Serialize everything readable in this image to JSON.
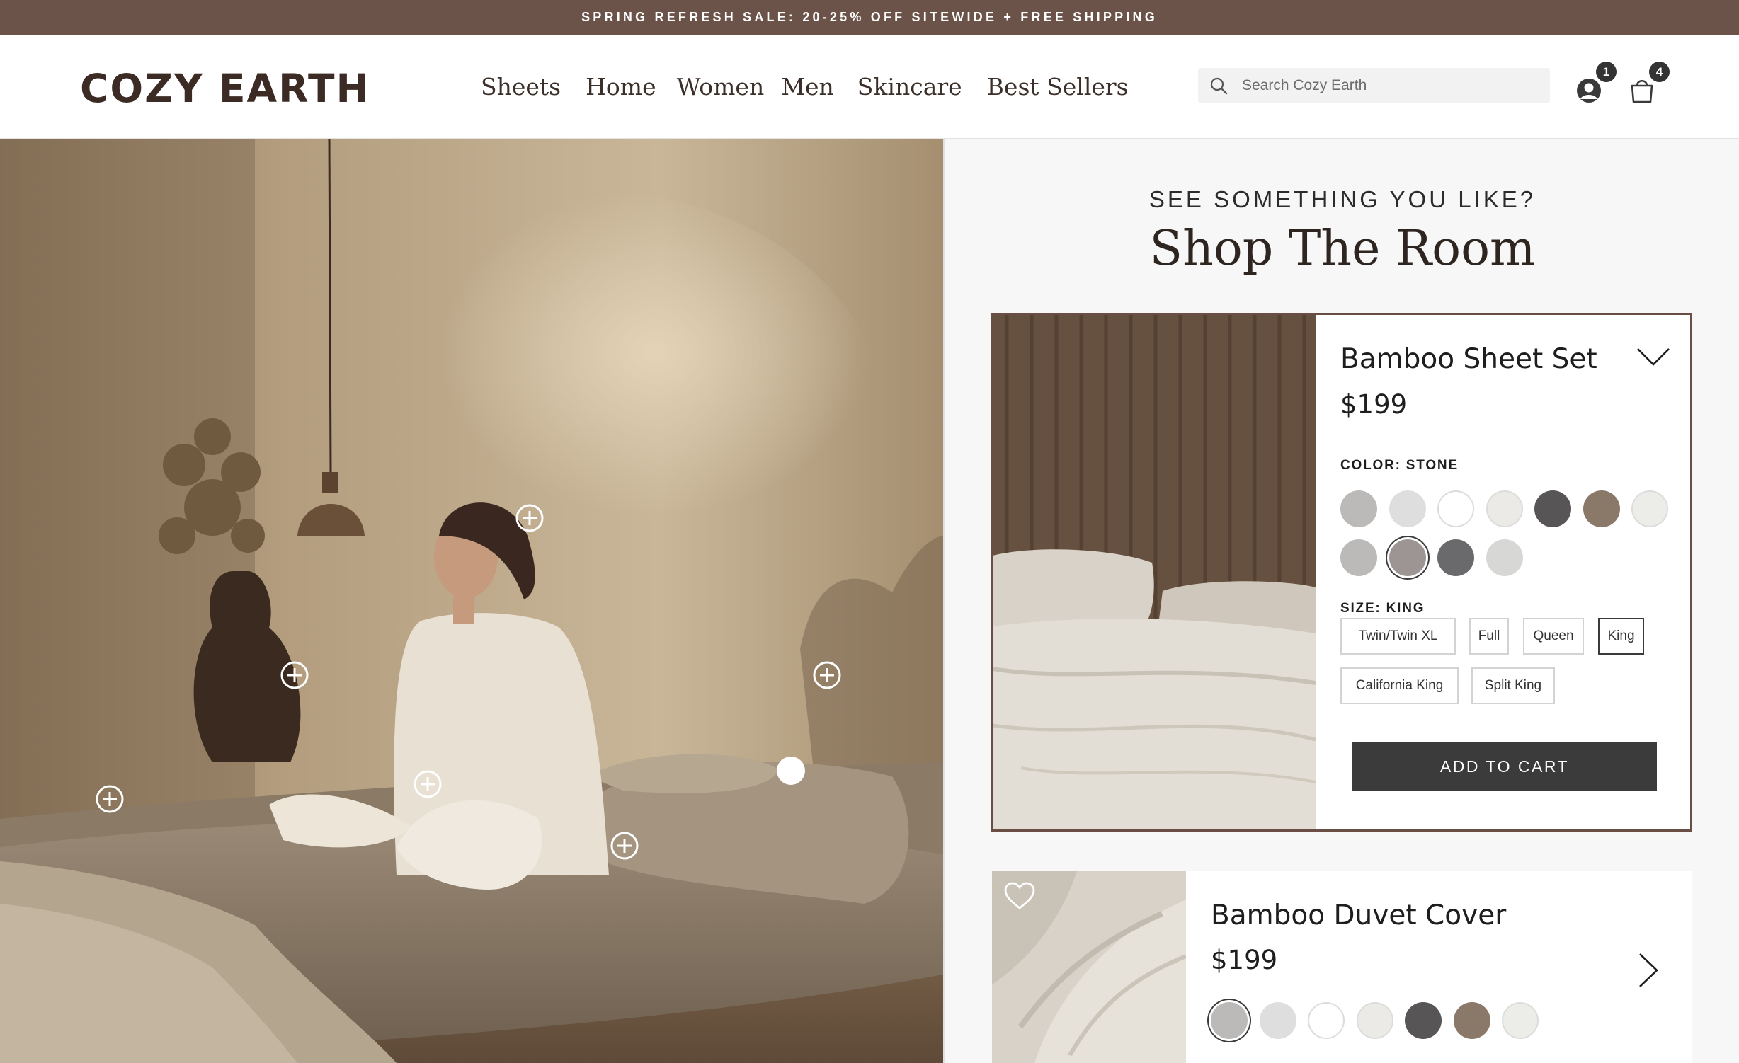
{
  "promo": {
    "text": "SPRING REFRESH SALE: 20-25% OFF SITEWIDE + FREE SHIPPING"
  },
  "header": {
    "logo": "COZY EARTH",
    "nav": [
      "Sheets",
      "Home",
      "Women",
      "Men",
      "Skincare",
      "Best Sellers"
    ],
    "search_placeholder": "Search Cozy Earth",
    "account_badge": "1",
    "cart_badge": "4",
    "icons": [
      "search-icon",
      "account-icon",
      "bag-icon"
    ]
  },
  "hero": {
    "hotspot_count": 7,
    "active_hotspot_count": 1
  },
  "panel": {
    "eyebrow": "SEE SOMETHING YOU LIKE?",
    "title": "Shop The Room",
    "product_main": {
      "name": "Bamboo Sheet Set",
      "price": "$199",
      "color_label": "COLOR: STONE",
      "colors": [
        "#bcbab8",
        "#dedede",
        "#ffffff",
        "#ebeae6",
        "#575556",
        "#8a7868",
        "#ecece8",
        "#bcbab8",
        "#9c9593",
        "#6a6a6c",
        "#d7d7d5"
      ],
      "selected_color_index": 8,
      "size_label": "SIZE: KING",
      "sizes": [
        "Twin/Twin XL",
        "Full",
        "Queen",
        "King",
        "California King",
        "Split King"
      ],
      "selected_size": "King",
      "cta": "ADD TO CART"
    },
    "product_second": {
      "name": "Bamboo Duvet Cover",
      "price": "$199",
      "colors": [
        "#bcbab8",
        "#dedede",
        "#ffffff",
        "#ebeae6",
        "#575556",
        "#8a7868",
        "#ecece8"
      ],
      "selected_color_index": 0
    }
  }
}
